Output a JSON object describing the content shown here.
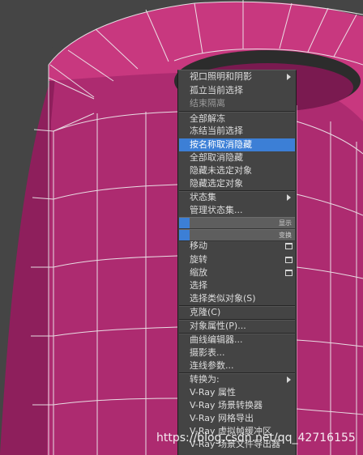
{
  "quad_menu": {
    "items": [
      {
        "label": "视口照明和阴影",
        "submenu": true
      },
      {
        "label": "孤立当前选择"
      },
      {
        "label": "结束隔离"
      },
      {
        "label": "全部解冻"
      },
      {
        "label": "冻结当前选择"
      },
      {
        "label": "按名称取消隐藏",
        "highlighted": true
      },
      {
        "label": "全部取消隐藏"
      },
      {
        "label": "隐藏未选定对象"
      },
      {
        "label": "隐藏选定对象"
      },
      {
        "label": "状态集",
        "submenu": true
      },
      {
        "label": "管理状态集..."
      },
      {
        "label": "移动"
      },
      {
        "label": "旋转"
      },
      {
        "label": "缩放"
      },
      {
        "label": "选择"
      },
      {
        "label": "选择类似对象(S)"
      },
      {
        "label": "克隆(C)"
      },
      {
        "label": "对象属性(P)..."
      },
      {
        "label": "曲线编辑器..."
      },
      {
        "label": "摄影表..."
      },
      {
        "label": "连线参数..."
      },
      {
        "label": "转换为:",
        "submenu": true
      },
      {
        "label": "V-Ray 属性"
      },
      {
        "label": "V-Ray 场景转换器"
      },
      {
        "label": "V-Ray 网格导出"
      },
      {
        "label": "V-Ray 虚拟帧缓冲区"
      },
      {
        "label": "V-Ray 场景文件导出器"
      }
    ],
    "headers": [
      {
        "label": "显示"
      },
      {
        "label": "变换"
      }
    ]
  },
  "watermark": "https://blog.csdn.net/qq_42716155",
  "colors": {
    "object": "#c8387f",
    "viewport_bg": "#454545",
    "highlight": "#3c7fd6"
  }
}
